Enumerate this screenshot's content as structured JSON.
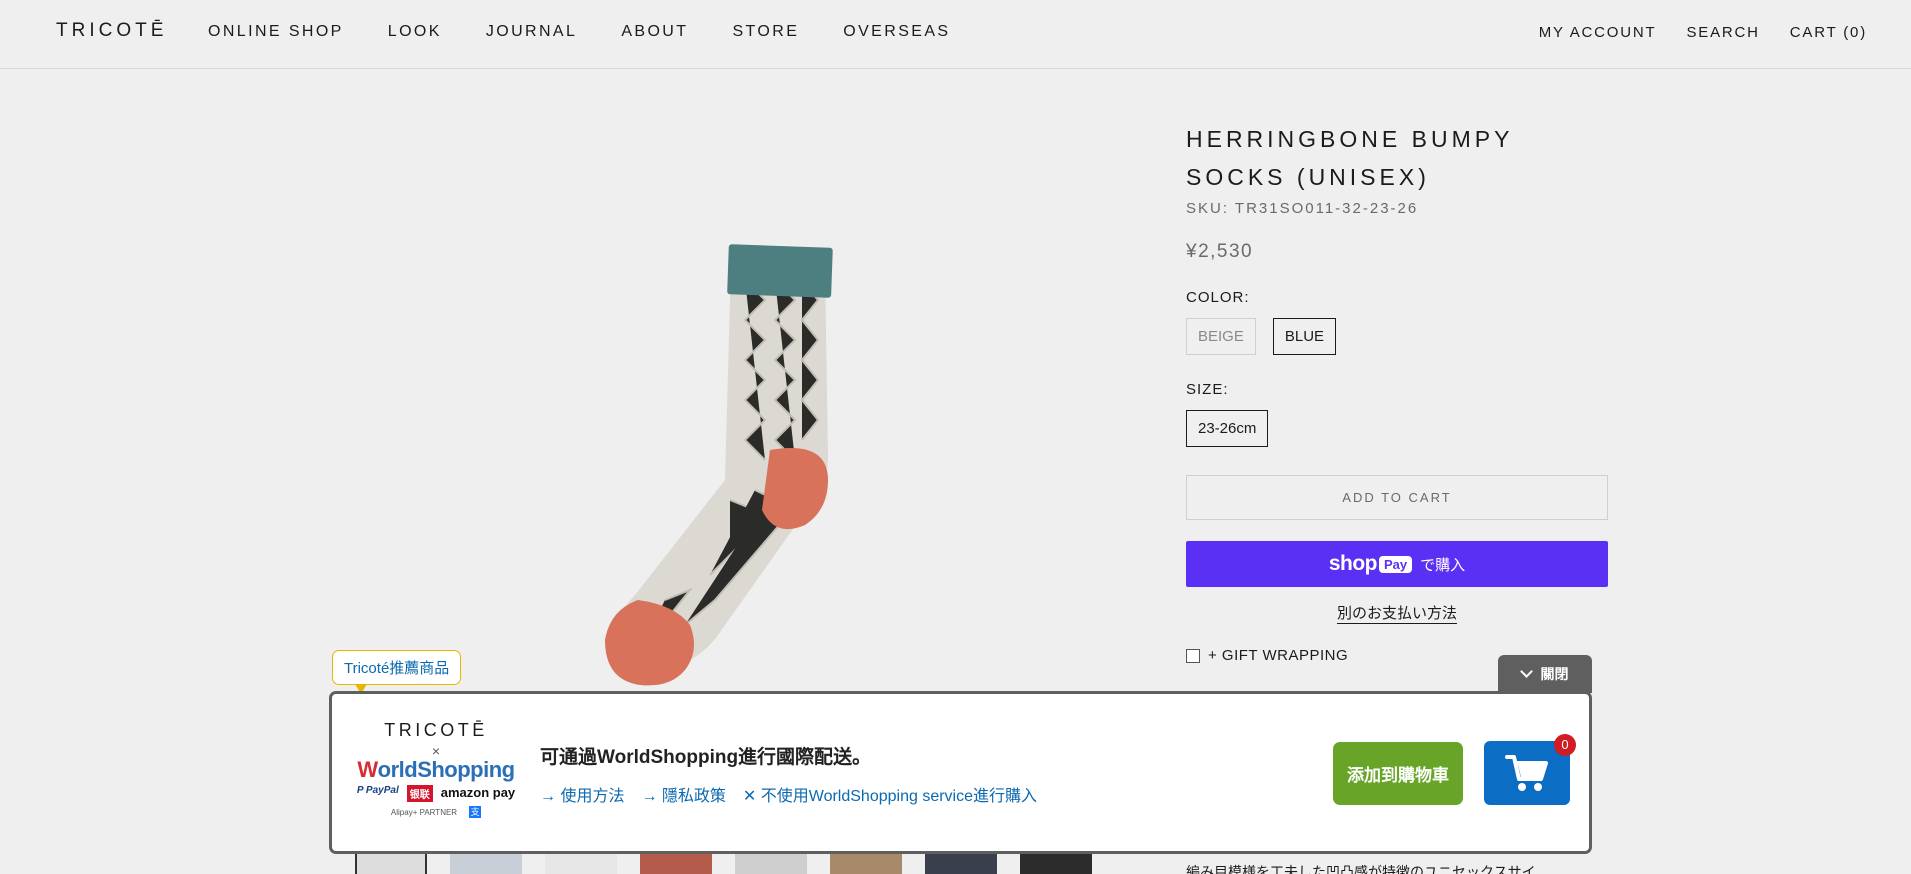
{
  "header": {
    "logo": "TRICOTĒ",
    "nav": [
      "ONLINE SHOP",
      "LOOK",
      "JOURNAL",
      "ABOUT",
      "STORE",
      "OVERSEAS"
    ],
    "account": "MY ACCOUNT",
    "search": "SEARCH",
    "cart": "CART (0)"
  },
  "product": {
    "title_line1": "HERRINGBONE BUMPY",
    "title_line2": "SOCKS (UNISEX)",
    "sku": "SKU: TR31SO011-32-23-26",
    "price": "¥2,530",
    "color_label": "COLOR:",
    "colors": [
      "BEIGE",
      "BLUE"
    ],
    "selected_color": "BLUE",
    "size_label": "SIZE:",
    "sizes": [
      "23-26cm"
    ],
    "add_to_cart": "ADD TO CART",
    "shoppay_shop": "shop",
    "shoppay_pay": "Pay",
    "shoppay_buy": "で購入",
    "alt_payment": "別のお支払い方法",
    "gift_wrapping": "+ GIFT WRAPPING",
    "description_partial": "編み目模様を工夫した凹凸感が特徴のユニセックスサイ"
  },
  "worldshopping": {
    "tag": "Tricoté推薦商品",
    "close": "關閉",
    "brand_logo": "TRICOTĒ",
    "times": "×",
    "ws_logo_w": "W",
    "ws_logo_rest": "orldShopping",
    "pay_paypal": "P PayPal",
    "pay_unionpay": "银联",
    "pay_amazon": "amazon pay",
    "alipay": "Alipay+ PARTNER",
    "alipay_icon": "支",
    "message": "可通過WorldShopping進行國際配送。",
    "links": [
      "→ 使用方法",
      "→ 隱私政策",
      "✕ 不使用WorldShopping service進行購入"
    ],
    "add_button": "添加到購物車",
    "cart_count": "0"
  },
  "colors": {
    "shoppay": "#5a31f4",
    "ws_green": "#68a428",
    "ws_blue": "#0b6dc3",
    "ws_link": "#0b6ab0"
  }
}
